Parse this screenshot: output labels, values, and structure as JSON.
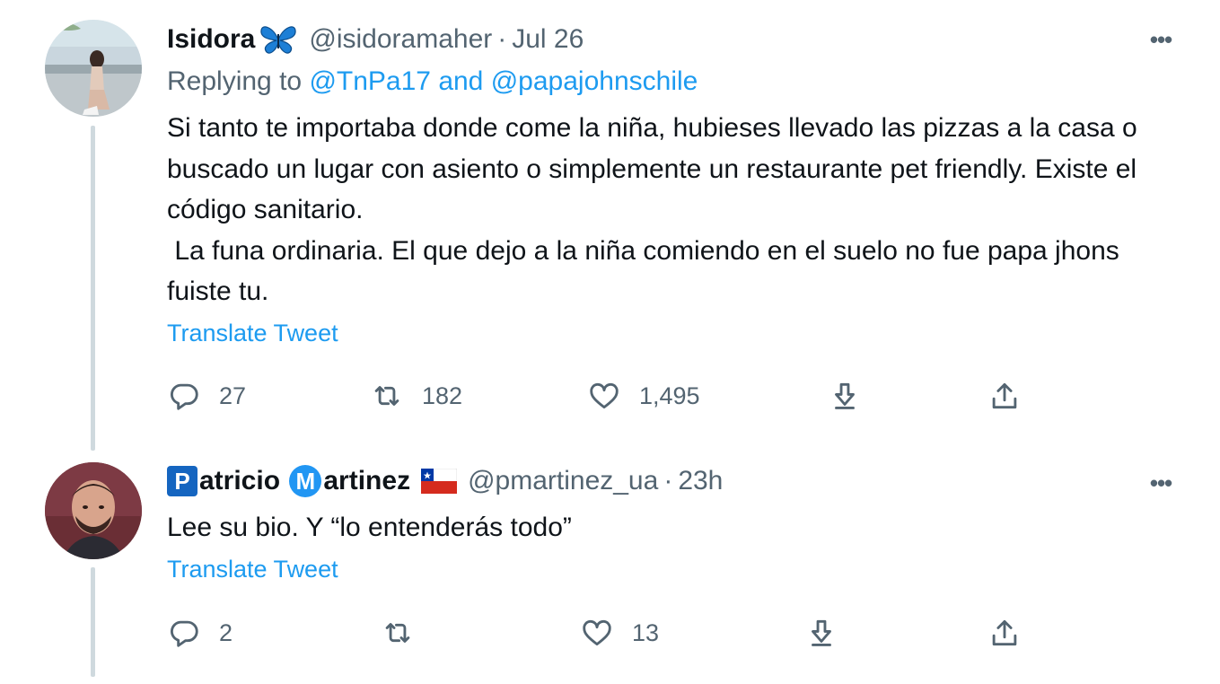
{
  "tweets": [
    {
      "display_name": "Isidora",
      "name_emoji": "butterfly",
      "handle": "@isidoramaher",
      "separator": "·",
      "time": "Jul 26",
      "more_label": "•••",
      "replying_prefix": "Replying to",
      "replying_user_1": "@TnPa17",
      "replying_and": "and",
      "replying_user_2": "@papajohnschile",
      "text": "Si tanto te importaba donde come la niña, hubieses llevado las pizzas a la casa o buscado un lugar con asiento o simplemente un restaurante pet friendly. Existe el código sanitario.\n La funa ordinaria. El que dejo a la niña comiendo en el suelo no fue papa jhons fuiste tu.",
      "translate_label": "Translate Tweet",
      "replies": "27",
      "retweets": "182",
      "likes": "1,495"
    },
    {
      "display_name_part_1": "atricio",
      "display_name_part_2": "artinez",
      "emblem_1": "P",
      "emblem_2": "M",
      "flag": "chile-flag",
      "handle": "@pmartinez_ua",
      "separator": "·",
      "time": "23h",
      "more_label": "•••",
      "text": "Lee su bio. Y “lo entenderás todo”",
      "translate_label": "Translate Tweet",
      "replies": "2",
      "retweets": "",
      "likes": "13"
    }
  ],
  "icons": {
    "reply": "reply-icon",
    "retweet": "retweet-icon",
    "like": "heart-icon",
    "save": "bookmark-down-icon",
    "share": "share-icon"
  },
  "colors": {
    "link": "#1d9bf0",
    "secondary_text": "#536471",
    "primary_text": "#0f1419",
    "thread_line": "#cfd9de",
    "butterfly": "#1d7fd6",
    "emblem_p": "#1565c0",
    "emblem_m": "#2196f3"
  }
}
